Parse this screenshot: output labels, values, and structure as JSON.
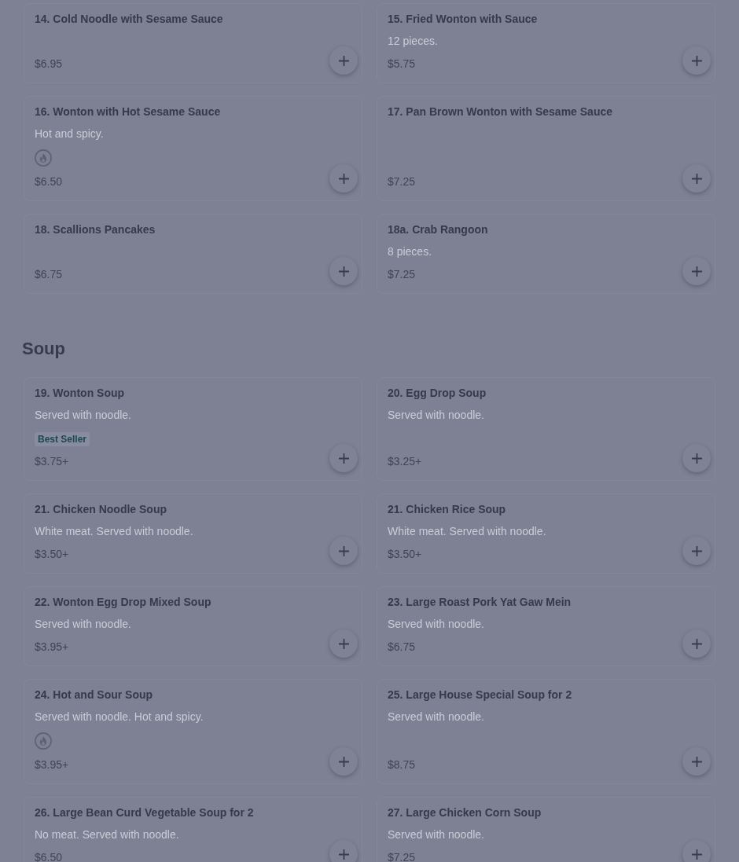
{
  "sections": [
    {
      "items": [
        {
          "name": "14. Cold Noodle with Sesame Sauce",
          "spicy": false,
          "price": "$6.95"
        },
        {
          "name": "15. Fried Wonton with Sauce",
          "description": "12 pieces.",
          "spicy": false,
          "price": "$5.75"
        },
        {
          "name": "16. Wonton with Hot Sesame Sauce",
          "description": "Hot and spicy.",
          "spicy": true,
          "price": "$6.50"
        },
        {
          "name": "17. Pan Brown Wonton with Sesame Sauce",
          "spicy": false,
          "price": "$7.25"
        },
        {
          "name": "18. Scallions Pancakes",
          "spicy": false,
          "price": "$6.75"
        },
        {
          "name": "18a. Crab Rangoon",
          "description": "8 pieces.",
          "spicy": false,
          "price": "$7.25"
        }
      ]
    },
    {
      "title": "Soup",
      "items": [
        {
          "name": "19. Wonton Soup",
          "description": "Served with noodle.",
          "badge": "Best Seller",
          "spicy": false,
          "price": "$3.75+"
        },
        {
          "name": "20. Egg Drop Soup",
          "description": "Served with noodle.",
          "spicy": false,
          "price": "$3.25+"
        },
        {
          "name": "21. Chicken Noodle Soup",
          "description": "White meat. Served with noodle.",
          "spicy": false,
          "price": "$3.50+"
        },
        {
          "name": "21. Chicken Rice Soup",
          "description": "White meat. Served with noodle.",
          "spicy": false,
          "price": "$3.50+"
        },
        {
          "name": "22. Wonton Egg Drop Mixed Soup",
          "description": "Served with noodle.",
          "spicy": false,
          "price": "$3.95+"
        },
        {
          "name": "23. Large Roast Pork Yat Gaw Mein",
          "description": "Served with noodle.",
          "spicy": false,
          "price": "$6.75"
        },
        {
          "name": "24. Hot and Sour Soup",
          "description": "Served with noodle. Hot and spicy.",
          "spicy": true,
          "price": "$3.95+"
        },
        {
          "name": "25. Large House Special Soup for 2",
          "description": "Served with noodle.",
          "spicy": false,
          "price": "$8.75"
        },
        {
          "name": "26. Large Bean Curd Vegetable Soup for 2",
          "description": "No meat. Served with noodle.",
          "spicy": false,
          "price": "$6.50"
        },
        {
          "name": "27. Large Chicken Corn Soup",
          "description": "Served with noodle.",
          "spicy": false,
          "price": "$7.25"
        }
      ]
    }
  ]
}
